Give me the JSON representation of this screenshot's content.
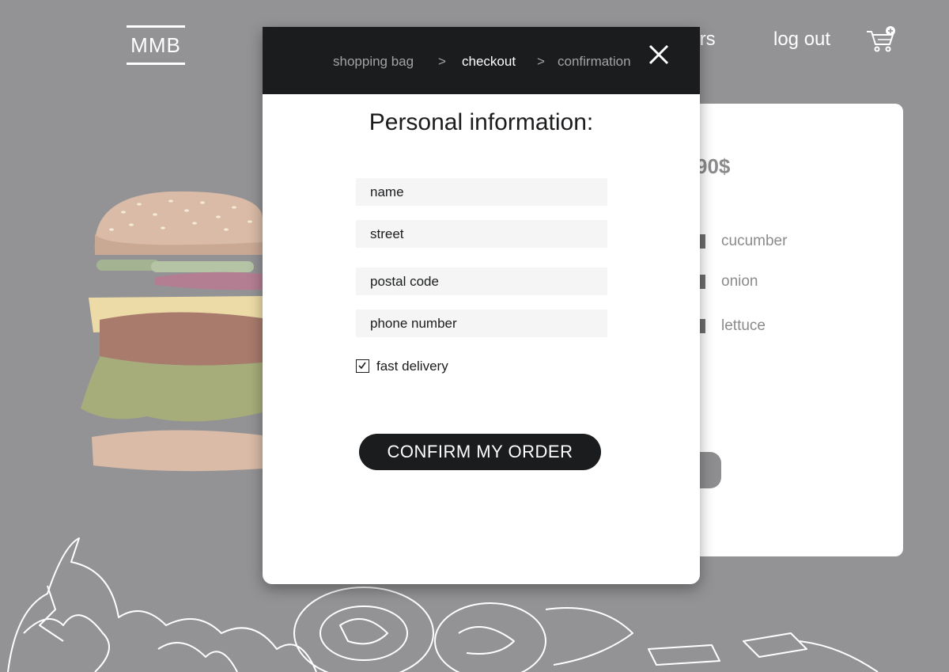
{
  "colors": {
    "page_background": "#939395",
    "header_dark": "#1b1c1e",
    "field_background": "#f4f5f4",
    "crumb_inactive": "#a3a3a3"
  },
  "background": {
    "logo": "MMB",
    "nav": {
      "orders_partial": "rders",
      "logout": "log out"
    },
    "cart_icon": "cart-plus-icon",
    "card": {
      "price_partial": "90$",
      "ingredients": [
        "cucumber",
        "onion",
        "lettuce"
      ]
    }
  },
  "modal": {
    "breadcrumb": {
      "steps": [
        "shopping bag",
        "checkout",
        "confirmation"
      ],
      "active_index": 1,
      "separator": ">"
    },
    "close_icon": "close-icon",
    "title": "Personal information:",
    "fields": {
      "name": {
        "placeholder": "name",
        "value": ""
      },
      "street": {
        "placeholder": "street",
        "value": ""
      },
      "postal_code": {
        "placeholder": "postal code",
        "value": ""
      },
      "phone_number": {
        "placeholder": "phone number",
        "value": ""
      }
    },
    "fast_delivery": {
      "label": "fast delivery",
      "checked": true
    },
    "confirm_button": "CONFIRM MY ORDER"
  }
}
